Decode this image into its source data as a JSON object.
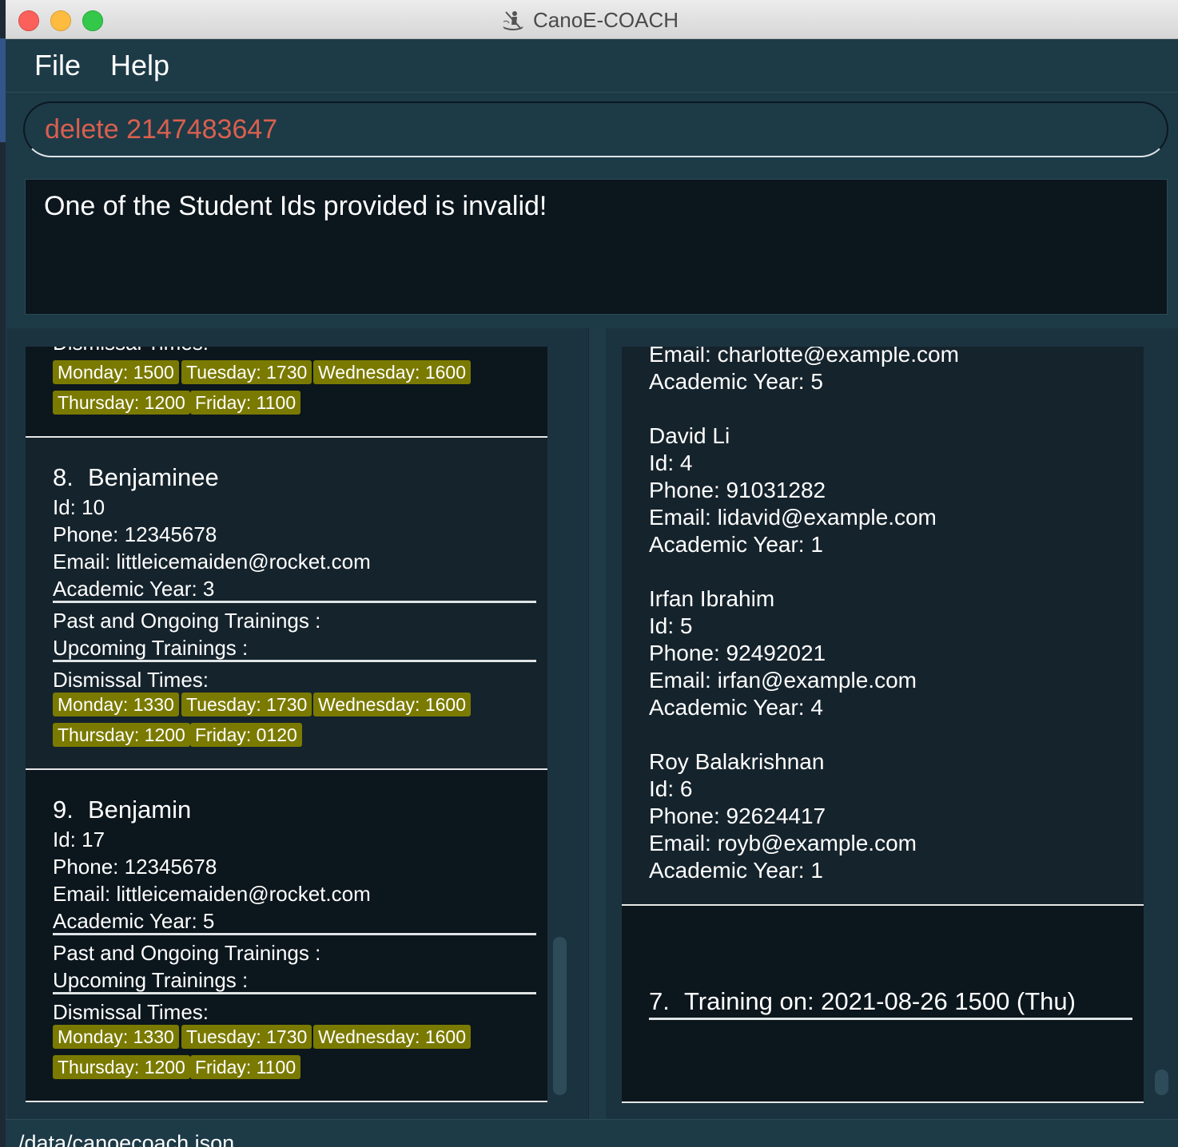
{
  "window": {
    "title": "CanoE-COACH",
    "icon": "canoe-icon"
  },
  "menu": {
    "items": [
      "File",
      "Help"
    ]
  },
  "command_box": {
    "value": "delete 2147483647"
  },
  "result_display": {
    "message": "One of the Student Ids provided is invalid!"
  },
  "student_list": {
    "top_partial": {
      "label": "Dismissal Times:",
      "tags": [
        "Monday: 1500",
        "Tuesday: 1730",
        "Wednesday: 1600",
        "Thursday: 1200",
        "Friday: 1100"
      ]
    },
    "cards": [
      {
        "index": "8.",
        "name": "Benjaminee",
        "id": "Id: 10",
        "phone": "Phone: 12345678",
        "email": "Email: littleicemaiden@rocket.com",
        "year": "Academic Year: 3",
        "past": "Past and Ongoing Trainings :",
        "upcoming": "Upcoming Trainings :",
        "dismissal_label": "Dismissal Times:",
        "tags": [
          "Monday: 1330",
          "Tuesday: 1730",
          "Wednesday: 1600",
          "Thursday: 1200",
          "Friday: 0120"
        ]
      },
      {
        "index": "9.",
        "name": "Benjamin",
        "id": "Id: 17",
        "phone": "Phone: 12345678",
        "email": "Email: littleicemaiden@rocket.com",
        "year": "Academic Year: 5",
        "past": "Past and Ongoing Trainings :",
        "upcoming": "Upcoming Trainings :",
        "dismissal_label": "Dismissal Times:",
        "tags": [
          "Monday: 1330",
          "Tuesday: 1730",
          "Wednesday: 1600",
          "Thursday: 1200",
          "Friday: 1100"
        ]
      }
    ]
  },
  "training_list": {
    "partial_top": [
      "Email: charlotte@example.com",
      "Academic  Year: 5"
    ],
    "students": [
      {
        "name": "David Li",
        "id": "Id: 4",
        "phone": "Phone: 91031282",
        "email": "Email: lidavid@example.com",
        "year": "Academic  Year: 1"
      },
      {
        "name": "Irfan Ibrahim",
        "id": "Id: 5",
        "phone": "Phone: 92492021",
        "email": "Email: irfan@example.com",
        "year": "Academic  Year: 4"
      },
      {
        "name": "Roy Balakrishnan",
        "id": "Id: 6",
        "phone": "Phone: 92624417",
        "email": "Email: royb@example.com",
        "year": "Academic  Year: 1"
      }
    ],
    "next_training": {
      "index": "7.",
      "title": "Training on: 2021-08-26 1500 (Thu)"
    }
  },
  "status_bar": {
    "path": "/data/canoecoach.json"
  },
  "colors": {
    "tag_bg": "#7a7a00",
    "command_text": "#d9604e",
    "panel_bg": "#1d3a47"
  }
}
